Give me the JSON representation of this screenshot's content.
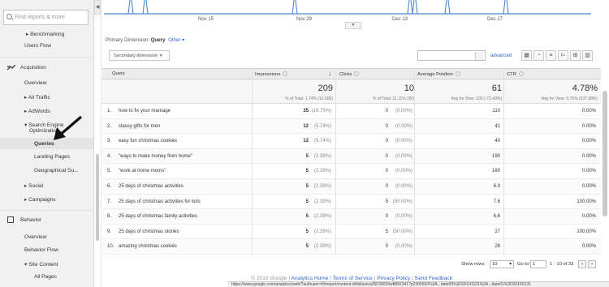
{
  "sidebar": {
    "search_placeholder": "Find reports & more",
    "items": [
      "Benchmarking",
      "Users Flow",
      "Acquisition",
      "Overview",
      "All Traffic",
      "AdWords",
      "Search Engine",
      "Optimization",
      "Queries",
      "Landing Pages",
      "Geographical Su...",
      "Social",
      "Campaigns",
      "Behavior",
      "Overview",
      "Behavior Flow",
      "Site Content",
      "All Pages"
    ]
  },
  "chart": {
    "dates": [
      "Nov 15",
      "Nov 29",
      "Dec 13",
      "Dec 27"
    ]
  },
  "toolbar": {
    "primary_dimension_label": "Primary Dimension:",
    "primary_dimension_value": "Query",
    "other_label": "Other",
    "secondary_dimension": "Secondary dimension",
    "advanced": "advanced"
  },
  "table": {
    "headers": [
      "Query",
      "Impressions",
      "Clicks",
      "Average Position",
      "CTR"
    ],
    "totals": {
      "impressions": "209",
      "impressions_sub": "% of Total: 1.74% (12,000)",
      "clicks": "10",
      "clicks_sub": "% of Total: 11.11% (90)",
      "avg_position": "61",
      "avg_position_sub": "Avg for View: 230 (-73.43%)",
      "ctr": "4.78%",
      "ctr_sub": "Avg for View: 0.75% (537.98%)"
    },
    "rows": [
      {
        "n": "1.",
        "q": "how to fix your marriage",
        "imp": "35",
        "imp_p": "(16.75%)",
        "clk": "0",
        "clk_p": "(0.00%)",
        "pos": "110",
        "ctr": "0.00%"
      },
      {
        "n": "2.",
        "q": "classy gifts for men",
        "imp": "12",
        "imp_p": "(5.74%)",
        "clk": "0",
        "clk_p": "(0.00%)",
        "pos": "41",
        "ctr": "0.00%"
      },
      {
        "n": "3.",
        "q": "easy fun christmas cookies",
        "imp": "12",
        "imp_p": "(5.74%)",
        "clk": "0",
        "clk_p": "(0.00%)",
        "pos": "40",
        "ctr": "0.00%"
      },
      {
        "n": "4.",
        "q": "\"ways to make money from home\"",
        "imp": "5",
        "imp_p": "(2.39%)",
        "clk": "0",
        "clk_p": "(0.00%)",
        "pos": "190",
        "ctr": "0.00%"
      },
      {
        "n": "5.",
        "q": "\"work at home moms\"",
        "imp": "5",
        "imp_p": "(2.39%)",
        "clk": "0",
        "clk_p": "(0.00%)",
        "pos": "180",
        "ctr": "0.00%"
      },
      {
        "n": "6.",
        "q": "25 days of christmas activities",
        "imp": "5",
        "imp_p": "(2.39%)",
        "clk": "0",
        "clk_p": "(0.00%)",
        "pos": "6.0",
        "ctr": "0.00%"
      },
      {
        "n": "7.",
        "q": "25 days of christmas activities for kids",
        "imp": "5",
        "imp_p": "(2.39%)",
        "clk": "5",
        "clk_p": "(50.00%)",
        "pos": "7.6",
        "ctr": "100.00%"
      },
      {
        "n": "8.",
        "q": "25 days of christmas family activities",
        "imp": "5",
        "imp_p": "(2.39%)",
        "clk": "0",
        "clk_p": "(0.00%)",
        "pos": "6.6",
        "ctr": "0.00%"
      },
      {
        "n": "9.",
        "q": "25 days of christmas stories",
        "imp": "5",
        "imp_p": "(2.39%)",
        "clk": "5",
        "clk_p": "(50.00%)",
        "pos": "27",
        "ctr": "100.00%"
      },
      {
        "n": "10.",
        "q": "amazing christmas cookies",
        "imp": "5",
        "imp_p": "(2.39%)",
        "clk": "0",
        "clk_p": "(0.00%)",
        "pos": "28",
        "ctr": "0.00%"
      }
    ]
  },
  "pager": {
    "show_rows": "Show rows:",
    "rows_value": "10",
    "goto": "Go to:",
    "goto_value": "1",
    "range": "1 - 10 of 33"
  },
  "footer": {
    "copyright": "© 2015 Google",
    "links": [
      "Analytics Home",
      "Terms of Service",
      "Privacy Policy",
      "Send Feedback"
    ],
    "sep": "|"
  },
  "status_url": "https://www.google.com/analytics/web/?authuser=0#report/content-drilldown/a26039039w8892341?p2305563%3A...date00%3D20141101%3A...date01%3D20150131"
}
